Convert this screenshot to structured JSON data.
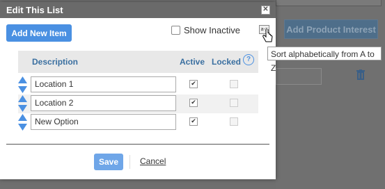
{
  "dialog": {
    "title": "Edit This List",
    "add_button": "Add New Item",
    "show_inactive_label": "Show Inactive",
    "sort_icon_text": "a-z",
    "tooltip": "Sort alphabetically from A to Z",
    "columns": {
      "description": "Description",
      "active": "Active",
      "locked": "Locked"
    },
    "help_text": "?",
    "rows": [
      {
        "description": "Location 1",
        "active": true,
        "locked": false
      },
      {
        "description": "Location 2",
        "active": true,
        "locked": false
      },
      {
        "description": "New Option",
        "active": true,
        "locked": false
      }
    ],
    "save_label": "Save",
    "cancel_label": "Cancel"
  },
  "background": {
    "button_label": "Add Product Interest"
  },
  "colors": {
    "accent": "#4a90e2",
    "titlebar": "#6a6a6a"
  }
}
